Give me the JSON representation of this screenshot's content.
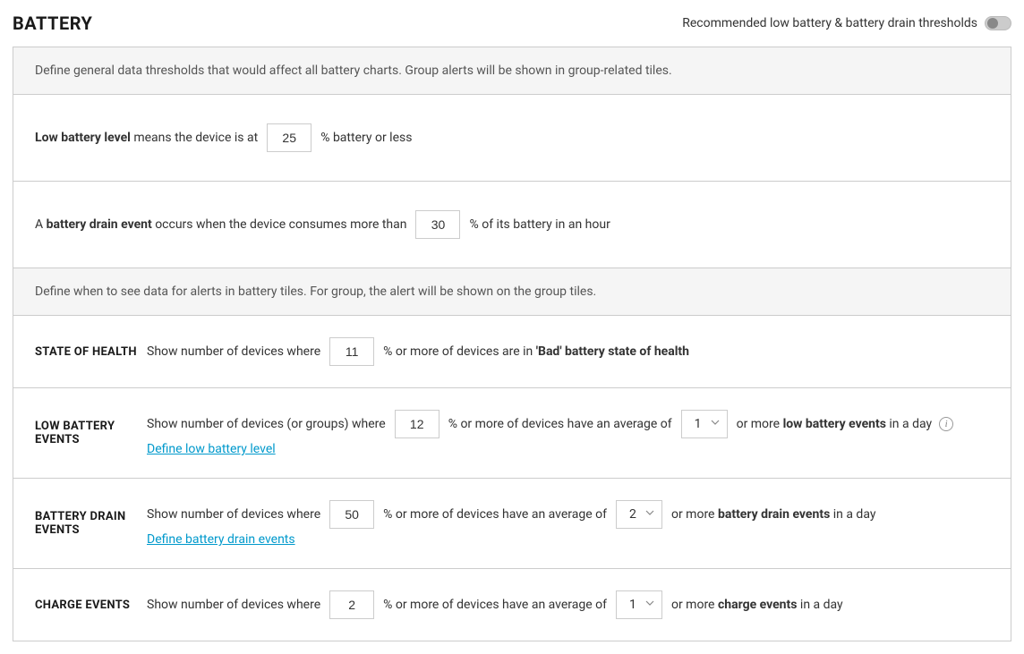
{
  "header": {
    "title": "BATTERY",
    "toggle_label": "Recommended low battery & battery drain thresholds"
  },
  "general": {
    "intro": "Define general data thresholds that would affect all battery charts. Group alerts will be shown in group-related tiles.",
    "low_battery": {
      "prefix_plain": " ",
      "label_bold": "Low battery level",
      "mid": " means the device is at",
      "value": "25",
      "suffix": "% battery or less"
    },
    "drain_event": {
      "prefix_plain": "A ",
      "label_bold": "battery drain event",
      "mid": " occurs when the device consumes more than",
      "value": "30",
      "suffix": "% of its battery in an hour"
    }
  },
  "alerts": {
    "intro": "Define when to see data for alerts in battery tiles. For group, the alert will be shown on the group tiles.",
    "state_of_health": {
      "label": "STATE OF HEALTH",
      "prefix": "Show number of devices where",
      "value": "11",
      "suffix_plain": "% or more of devices are in ",
      "suffix_bold": "'Bad' battery state of health"
    },
    "low_battery_events": {
      "label": "LOW BATTERY EVENTS",
      "prefix": "Show number of devices (or groups) where",
      "value": "12",
      "mid": "% or more of devices have an average of",
      "select_value": "1",
      "suffix_plain1": "or more ",
      "suffix_bold": "low battery events",
      "suffix_plain2": " in a day",
      "link": "Define low battery level"
    },
    "battery_drain_events": {
      "label": "BATTERY DRAIN EVENTS",
      "prefix": "Show number of devices where",
      "value": "50",
      "mid": "% or more of devices have an average of",
      "select_value": "2",
      "suffix_plain1": "or more ",
      "suffix_bold": "battery drain events",
      "suffix_plain2": " in a day",
      "link": "Define battery drain events"
    },
    "charge_events": {
      "label": "CHARGE EVENTS",
      "prefix": "Show number of devices where",
      "value": "2",
      "mid": "% or more of devices have an average of",
      "select_value": "1",
      "suffix_plain1": "or more ",
      "suffix_bold": "charge events",
      "suffix_plain2": " in a day"
    }
  }
}
